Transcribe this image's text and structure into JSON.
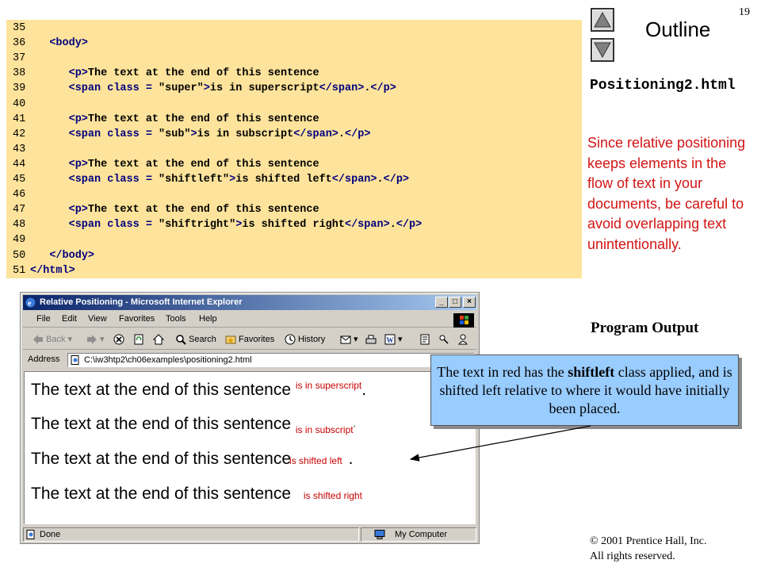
{
  "slide_number": "19",
  "outline": {
    "title": "Outline"
  },
  "code": {
    "lines": [
      {
        "num": "35",
        "parts": []
      },
      {
        "num": "36",
        "indent": "   ",
        "parts": [
          {
            "t": "tag",
            "v": "<body>"
          }
        ]
      },
      {
        "num": "37",
        "parts": []
      },
      {
        "num": "38",
        "indent": "      ",
        "parts": [
          {
            "t": "tag",
            "v": "<p>"
          },
          {
            "t": "tx",
            "v": "The text at the end of this sentence"
          }
        ]
      },
      {
        "num": "39",
        "indent": "      ",
        "parts": [
          {
            "t": "tag",
            "v": "<span class = "
          },
          {
            "t": "tx",
            "v": "\"super\""
          },
          {
            "t": "tag",
            "v": ">"
          },
          {
            "t": "tx",
            "v": "is in superscript"
          },
          {
            "t": "tag",
            "v": "</span>"
          },
          {
            "t": "tx",
            "v": "."
          },
          {
            "t": "tag",
            "v": "</p>"
          }
        ]
      },
      {
        "num": "40",
        "parts": []
      },
      {
        "num": "41",
        "indent": "      ",
        "parts": [
          {
            "t": "tag",
            "v": "<p>"
          },
          {
            "t": "tx",
            "v": "The text at the end of this sentence"
          }
        ]
      },
      {
        "num": "42",
        "indent": "      ",
        "parts": [
          {
            "t": "tag",
            "v": "<span class = "
          },
          {
            "t": "tx",
            "v": "\"sub\""
          },
          {
            "t": "tag",
            "v": ">"
          },
          {
            "t": "tx",
            "v": "is in subscript"
          },
          {
            "t": "tag",
            "v": "</span>"
          },
          {
            "t": "tx",
            "v": "."
          },
          {
            "t": "tag",
            "v": "</p>"
          }
        ]
      },
      {
        "num": "43",
        "parts": []
      },
      {
        "num": "44",
        "indent": "      ",
        "parts": [
          {
            "t": "tag",
            "v": "<p>"
          },
          {
            "t": "tx",
            "v": "The text at the end of this sentence"
          }
        ]
      },
      {
        "num": "45",
        "indent": "      ",
        "parts": [
          {
            "t": "tag",
            "v": "<span class = "
          },
          {
            "t": "tx",
            "v": "\"shiftleft\""
          },
          {
            "t": "tag",
            "v": ">"
          },
          {
            "t": "tx",
            "v": "is shifted left"
          },
          {
            "t": "tag",
            "v": "</span>"
          },
          {
            "t": "tx",
            "v": "."
          },
          {
            "t": "tag",
            "v": "</p>"
          }
        ]
      },
      {
        "num": "46",
        "parts": []
      },
      {
        "num": "47",
        "indent": "      ",
        "parts": [
          {
            "t": "tag",
            "v": "<p>"
          },
          {
            "t": "tx",
            "v": "The text at the end of this sentence"
          }
        ]
      },
      {
        "num": "48",
        "indent": "      ",
        "parts": [
          {
            "t": "tag",
            "v": "<span class = "
          },
          {
            "t": "tx",
            "v": "\"shiftright\""
          },
          {
            "t": "tag",
            "v": ">"
          },
          {
            "t": "tx",
            "v": "is shifted right"
          },
          {
            "t": "tag",
            "v": "</span>"
          },
          {
            "t": "tx",
            "v": "."
          },
          {
            "t": "tag",
            "v": "</p>"
          }
        ]
      },
      {
        "num": "49",
        "parts": []
      },
      {
        "num": "50",
        "indent": "   ",
        "parts": [
          {
            "t": "tag",
            "v": "</body>"
          }
        ]
      },
      {
        "num": "51",
        "indent": "",
        "parts": [
          {
            "t": "tag",
            "v": "</html>"
          }
        ]
      }
    ]
  },
  "filename": "Positioning2.html",
  "side_note": "Since relative positioning keeps elements in the flow of text in your documents, be careful to avoid overlapping text unintentionally.",
  "program_output_label": "Program Output",
  "browser": {
    "title": "Relative Positioning - Microsoft Internet Explorer",
    "window_buttons": [
      "_",
      "□",
      "×"
    ],
    "menu": [
      "File",
      "Edit",
      "View",
      "Favorites",
      "Tools",
      "Help"
    ],
    "toolbar": {
      "back": "Back",
      "search": "Search",
      "favorites": "Favorites",
      "history": "History"
    },
    "address_label": "Address",
    "address_value": "C:\\iw3htp2\\ch06examples\\positioning2.html",
    "content": {
      "sentence": "The text at the end of this sentence",
      "superscript": "is in superscript",
      "subscript": "is in subscript",
      "shifted_left": "is shifted left",
      "shifted_right": "is shifted right",
      "period": "."
    },
    "status": {
      "left": "Done",
      "zone": "My Computer"
    }
  },
  "callout": {
    "before": "The text in red has the ",
    "bold": "shiftleft",
    "after": " class applied, and is shifted left relative to where it would have initially been placed."
  },
  "copyright": {
    "line1": "© 2001 Prentice Hall, Inc.",
    "line2": "All rights reserved."
  },
  "colors": {
    "code_bg": "#fde39b",
    "note_red": "#d21414",
    "callout_bg": "#99ccff",
    "span_red": "#c80000"
  }
}
